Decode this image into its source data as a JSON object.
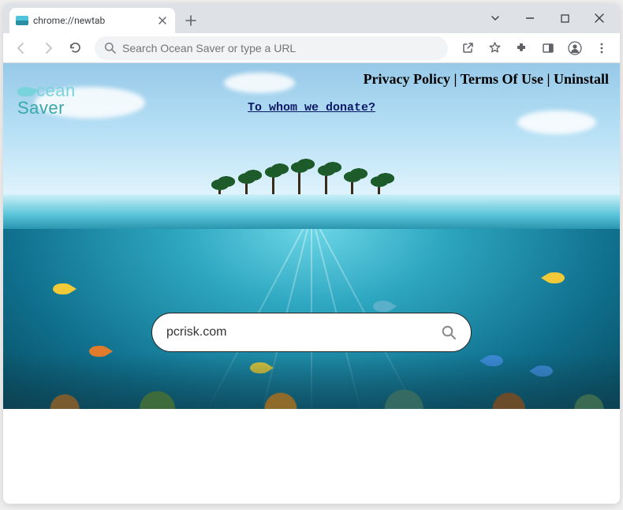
{
  "tab": {
    "title": "chrome://newtab"
  },
  "omnibox": {
    "placeholder": "Search Ocean Saver or type a URL"
  },
  "header": {
    "privacy": "Privacy Policy",
    "terms": "Terms Of Use",
    "uninstall": "Uninstall",
    "sep": " | "
  },
  "logo": {
    "line1": "cean",
    "line2": "Saver"
  },
  "donate": {
    "label": "To whom we donate?"
  },
  "search": {
    "value": "pcrisk.com"
  }
}
